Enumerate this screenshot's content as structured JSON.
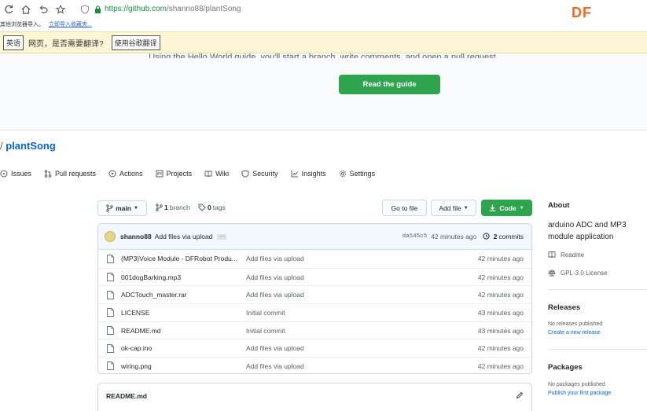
{
  "browser": {
    "url_prefix": "https://",
    "url_domain": "github.com",
    "url_path": "/shanno88/plantSong",
    "bookmark_text": "其他浏览器导入。",
    "bookmark_link": "立即导入收藏夹...",
    "brand_logo": "DF"
  },
  "translate": {
    "lang": "英语",
    "question": "网页，是否需要翻译?",
    "button": "使用谷歌翻译"
  },
  "hero": {
    "text": "Using the Hello World guide, you'll start a branch, write comments, and open a pull request.",
    "button": "Read the guide"
  },
  "repo": {
    "slash": "/",
    "name": "plantSong"
  },
  "tabs": [
    {
      "label": "Issues",
      "icon": "issue-icon"
    },
    {
      "label": "Pull requests",
      "icon": "pull-request-icon"
    },
    {
      "label": "Actions",
      "icon": "actions-icon"
    },
    {
      "label": "Projects",
      "icon": "projects-icon"
    },
    {
      "label": "Wiki",
      "icon": "wiki-icon"
    },
    {
      "label": "Security",
      "icon": "shield-icon"
    },
    {
      "label": "Insights",
      "icon": "graph-icon"
    },
    {
      "label": "Settings",
      "icon": "gear-icon"
    }
  ],
  "controls": {
    "branch": "main",
    "branch_count": "1",
    "branch_label": "branch",
    "tag_count": "0",
    "tag_label": "tags",
    "goto_file": "Go to file",
    "add_file": "Add file",
    "code": "Code"
  },
  "commit": {
    "author": "shanno88",
    "message": "Add files via upload",
    "sha": "da545c5",
    "time": "42 minutes ago",
    "count": "2",
    "count_label": "commits"
  },
  "files": [
    {
      "name": "(MP3)Voice Module - DFRobot Produ...",
      "commit": "Add files via upload",
      "age": "42 minutes ago"
    },
    {
      "name": "001dogBarking.mp3",
      "commit": "Add files via upload",
      "age": "42 minutes ago"
    },
    {
      "name": "ADCTouch_master.rar",
      "commit": "Add files via upload",
      "age": "42 minutes ago"
    },
    {
      "name": "LICENSE",
      "commit": "Initial commit",
      "age": "43 minutes ago"
    },
    {
      "name": "README.md",
      "commit": "Initial commit",
      "age": "43 minutes ago"
    },
    {
      "name": "ok-cap.ino",
      "commit": "Add files via upload",
      "age": "42 minutes ago"
    },
    {
      "name": "wiring.png",
      "commit": "Add files via upload",
      "age": "42 minutes ago"
    }
  ],
  "readme": {
    "title": "README.md"
  },
  "sidebar": {
    "about_heading": "About",
    "about_desc": "arduino ADC and MP3 module application",
    "readme_label": "Readme",
    "license_label": "GPL-3.0 License",
    "releases_heading": "Releases",
    "releases_none": "No releases published",
    "releases_link": "Create a new release",
    "packages_heading": "Packages",
    "packages_none": "No packages published",
    "packages_link": "Publish your first package"
  },
  "colors": {
    "green": "#2ea44f",
    "link": "#0366d6",
    "translate_bg": "#fdf6d6",
    "brand": "#f26b21"
  }
}
